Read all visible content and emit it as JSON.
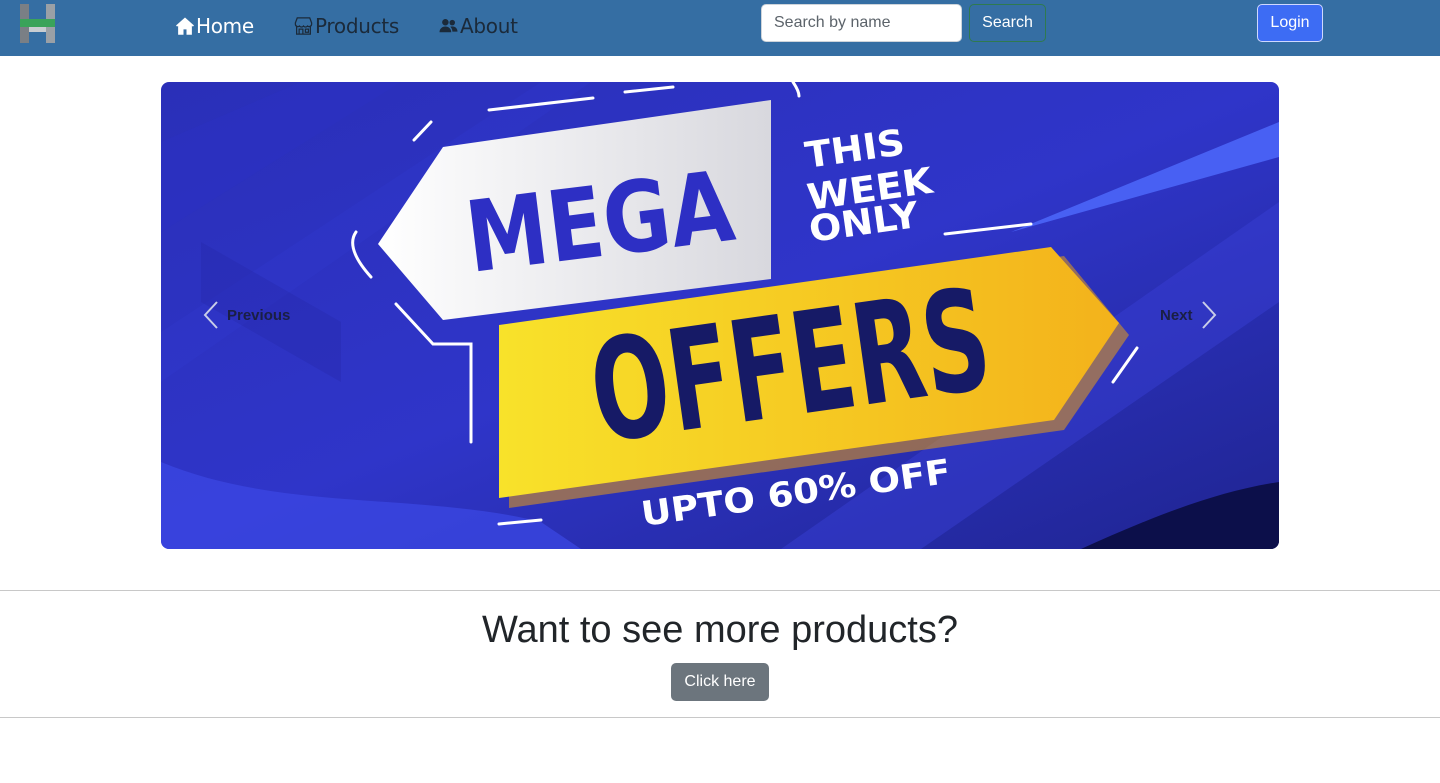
{
  "navbar": {
    "logo_icon": "h-letter-logo",
    "links": [
      {
        "label": "Home",
        "icon": "house-icon"
      },
      {
        "label": "Products",
        "icon": "shop-icon"
      },
      {
        "label": "About",
        "icon": "people-icon"
      }
    ],
    "search": {
      "placeholder": "Search by name",
      "value": "",
      "button_label": "Search"
    },
    "login_label": "Login",
    "colors": {
      "bar": "#356ea3",
      "login": "#3d6cf4",
      "search_border": "#2f7a4f"
    }
  },
  "carousel": {
    "banner": {
      "headline": "MEGA",
      "tagline_lines": [
        "THIS",
        "WEEK",
        "ONLY"
      ],
      "offer": "OFFERS",
      "discount": "UPTO 60% OFF"
    },
    "prev_label": "Previous",
    "next_label": "Next",
    "colors": {
      "background": "#2f2fc0",
      "ribbon": "#f6c419",
      "text_dark": "#1a1f66"
    }
  },
  "cta": {
    "heading": "Want to see more products?",
    "button_label": "Click here",
    "button_color": "#6c757d"
  }
}
